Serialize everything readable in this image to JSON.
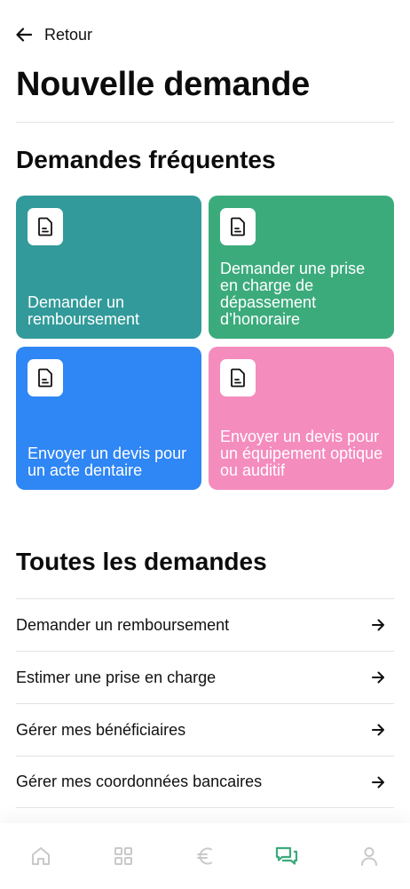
{
  "header": {
    "back_label": "Retour",
    "page_title": "Nouvelle demande"
  },
  "frequent": {
    "title": "Demandes fréquentes",
    "tiles": [
      {
        "label": "Demander un remboursement",
        "color": "#329a9a",
        "icon": "document-icon"
      },
      {
        "label": "Demander une prise en charge de dépassement d’honoraire",
        "color": "#3cab7c",
        "icon": "document-icon"
      },
      {
        "label": "Envoyer un devis pour un acte dentaire",
        "color": "#2f86f5",
        "icon": "document-icon"
      },
      {
        "label": "Envoyer un devis pour un équipement optique ou auditif",
        "color": "#f48cbe",
        "icon": "document-icon"
      }
    ]
  },
  "all": {
    "title": "Toutes les demandes",
    "items": [
      {
        "label": "Demander un remboursement",
        "icon": "arrow-right-icon"
      },
      {
        "label": "Estimer une prise en charge",
        "icon": "arrow-right-icon"
      },
      {
        "label": "Gérer mes bénéficiaires",
        "icon": "arrow-right-icon"
      },
      {
        "label": "Gérer mes coordonnées bancaires",
        "icon": "arrow-right-icon"
      }
    ]
  },
  "bottom_nav": {
    "items": [
      {
        "icon": "home-icon",
        "active": false
      },
      {
        "icon": "grid-icon",
        "active": false
      },
      {
        "icon": "euro-icon",
        "active": false
      },
      {
        "icon": "chat-icon",
        "active": true
      },
      {
        "icon": "user-icon",
        "active": false
      }
    ],
    "active_color": "#3cab7c",
    "inactive_color": "#c9c9c9"
  }
}
